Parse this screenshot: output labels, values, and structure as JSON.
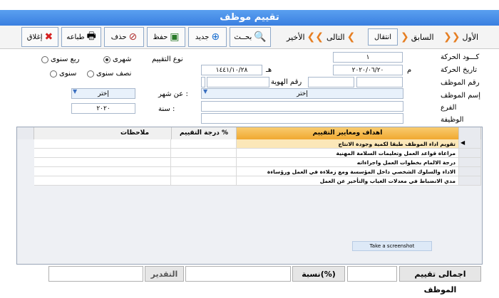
{
  "window": {
    "title": "تقييم موظف"
  },
  "toolbar": {
    "close_label": "إغلاق",
    "print_label": "طباعه",
    "delete_label": "حذف",
    "save_label": "حفظ",
    "new_label": "جديد",
    "search_label": "بحــث",
    "nav": {
      "last": "الأخير",
      "next": "التالى",
      "goto": "انتقال",
      "prev": "السابق",
      "first": "الأول"
    }
  },
  "form": {
    "labels": {
      "movement_code": "كـــود الحركة",
      "movement_date": "تاريخ الحركة",
      "employee_no": "رقم الموظف",
      "employee_name": "إسم الموظف",
      "branch": "الفرع",
      "job": "الوظيفة",
      "id_no": "رقم الهوية",
      "eval_type": "نوع التقييم",
      "month": "عن شهر :",
      "year": "سنة :",
      "m_suffix": "م",
      "h_suffix": "هـ"
    },
    "values": {
      "movement_code": "١",
      "movement_date": "٢٠٢٠/٠٦/٢٠",
      "hijri_date": "١٤٤١/١٠/٢٨",
      "employee_name": "إختر",
      "month": "إختر",
      "year": "٢٠٢٠"
    },
    "radios": {
      "monthly": "شهرى",
      "quarterly": "ربع سنوى",
      "half_yearly": "نصف سنوى",
      "yearly": "سنوى",
      "selected": "monthly"
    }
  },
  "grid": {
    "headers": {
      "criteria": "اهداف ومعايير التقييم",
      "score": "درجة التقييم %",
      "notes": "ملاحظات"
    },
    "rows": [
      "تقويم اداء الموظف طبقا لكمية وجودة الانتاج",
      "مراعاة قواعد العمل وتعليمات السلامة المهنية",
      "درجة الالمام بخطوات العمل واجراءاته",
      "الاداء والسلوك الشخصي داخل المؤسسة ومع زملاءة في العمل ورؤساءة",
      "مدي الانضباط في معدلات الغياب والتأخير عن العمل"
    ],
    "tooltip": "Take a screenshot"
  },
  "footer": {
    "total_label": "اجمالى تقييم الموظف",
    "percent_label": "نسبة(%)",
    "grade_label": "التقدير"
  },
  "colors": {
    "title": "#3a7fe0",
    "header": "#f5b84a"
  }
}
